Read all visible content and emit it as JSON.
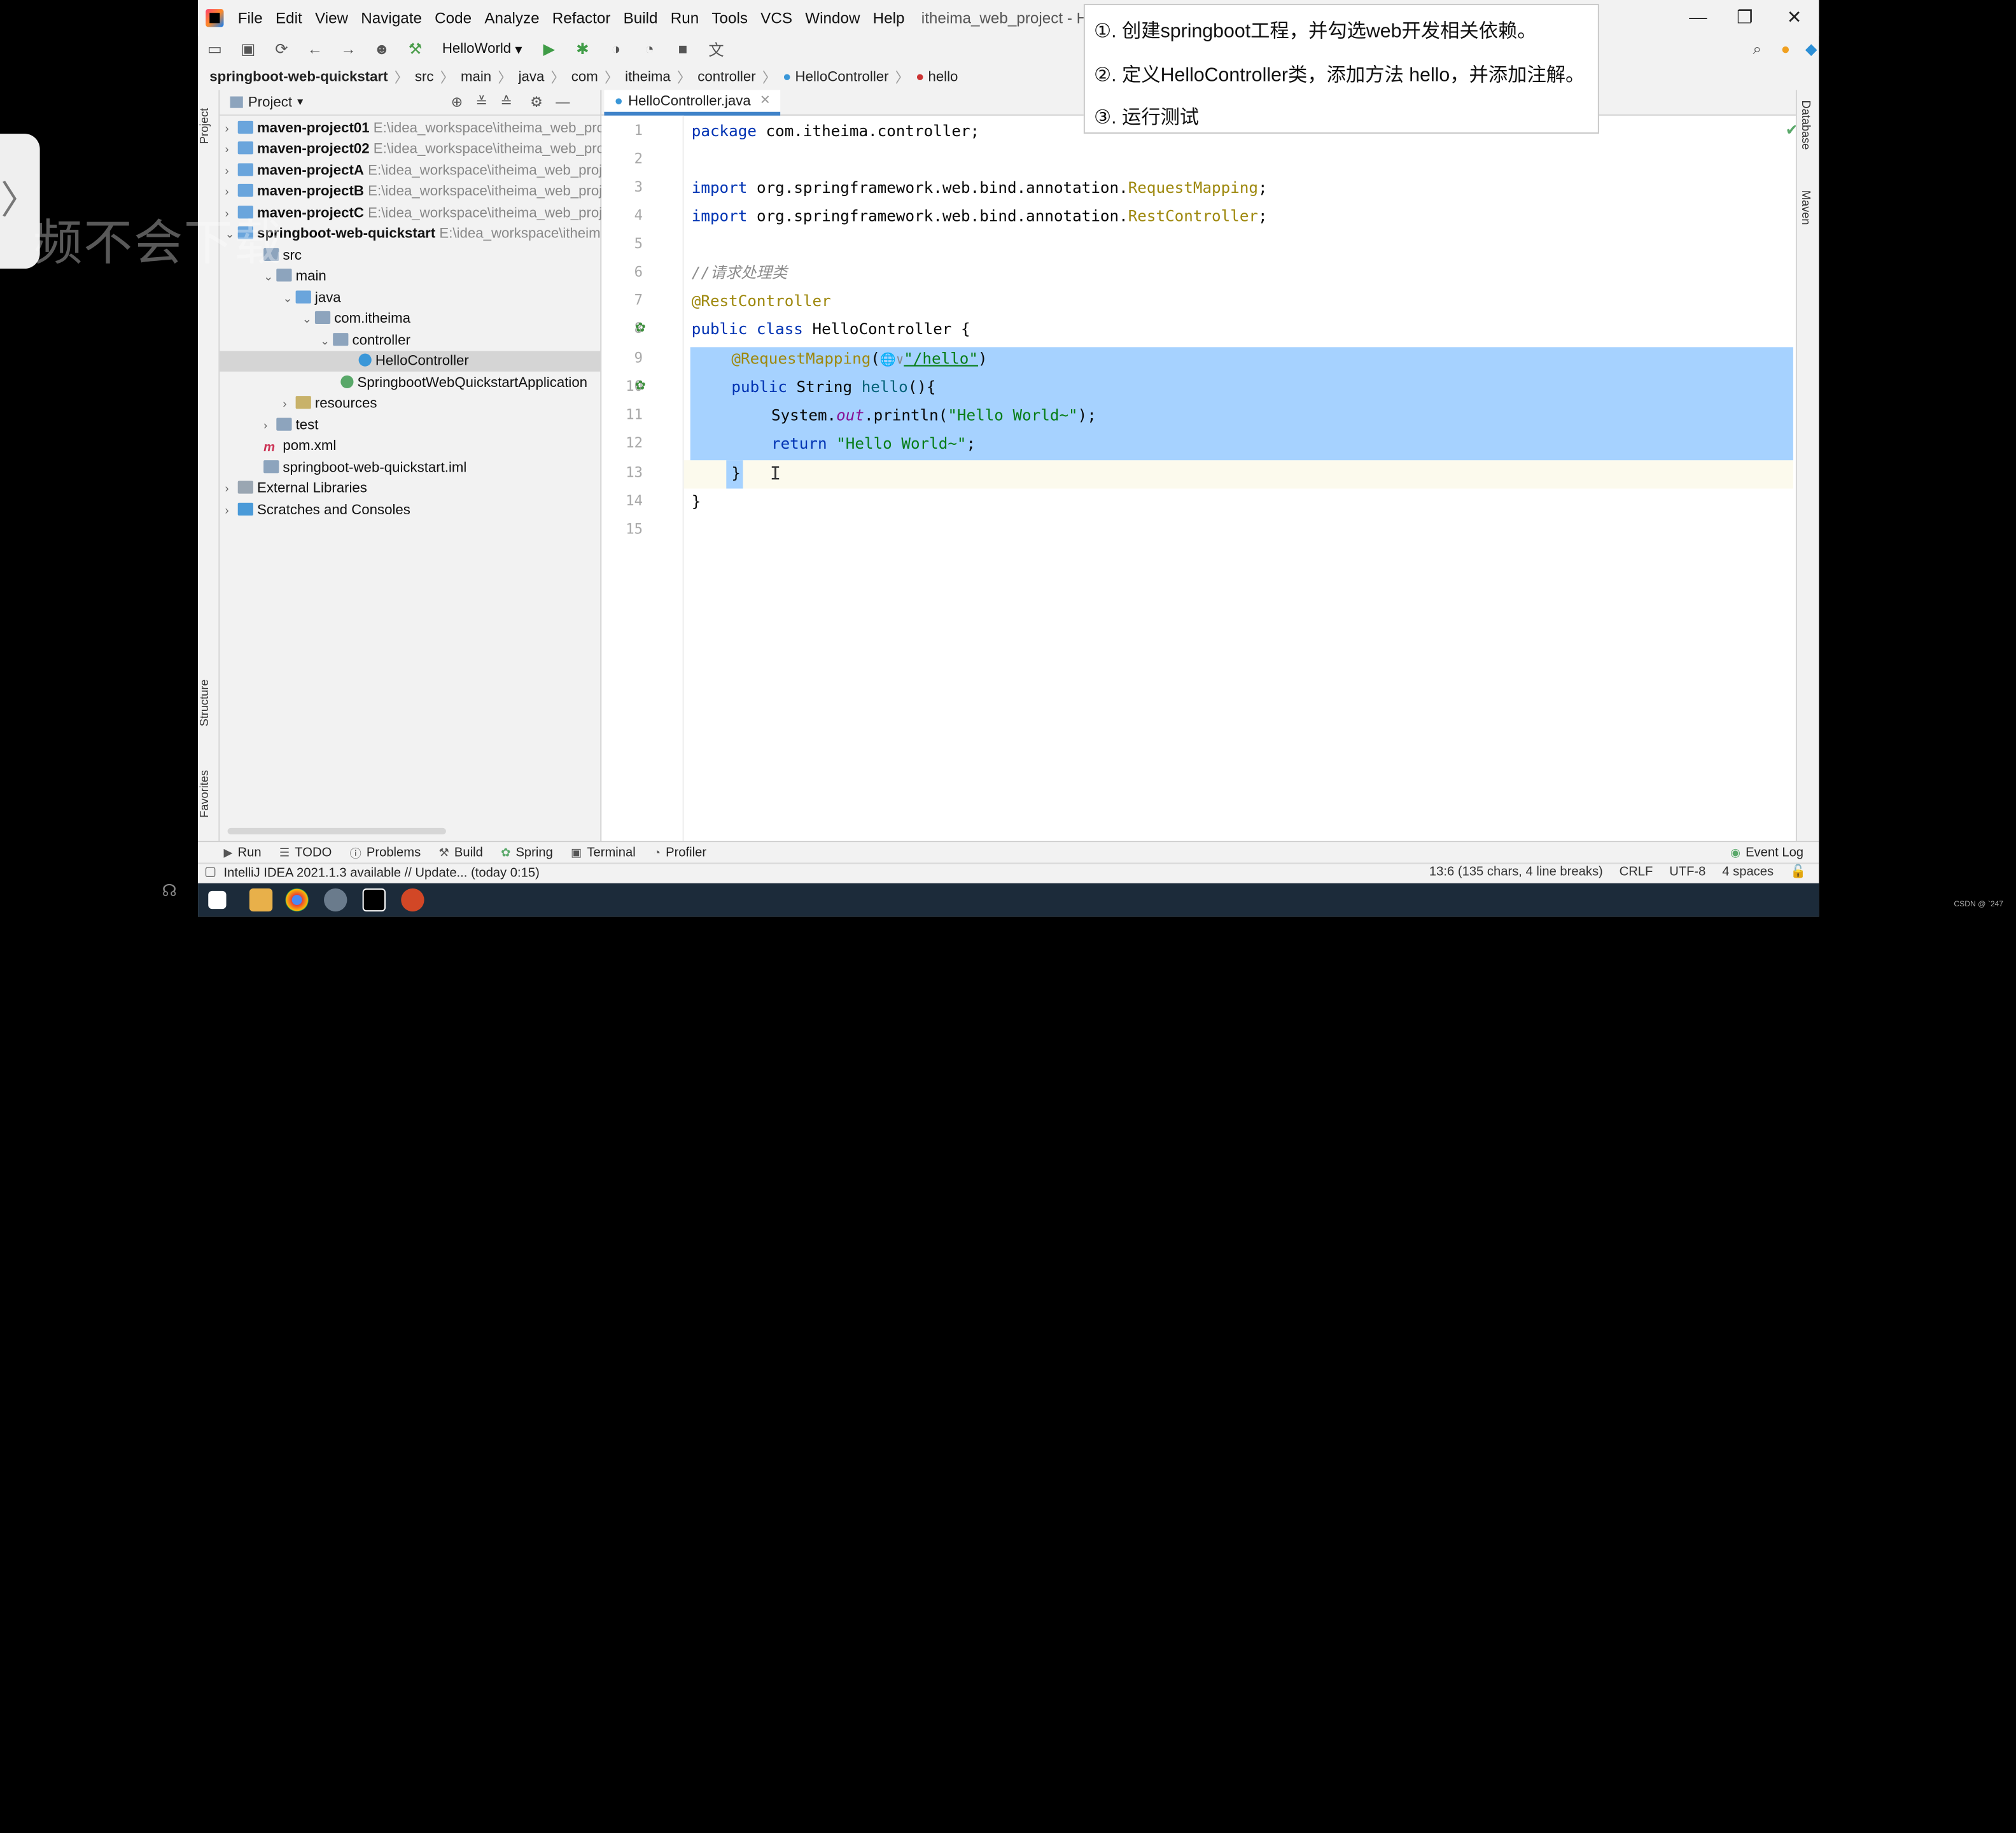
{
  "overlay": {
    "side_arrow": "〉",
    "text": "频不会下载"
  },
  "menu": {
    "items": [
      "File",
      "Edit",
      "View",
      "Navigate",
      "Code",
      "Analyze",
      "Refactor",
      "Build",
      "Run",
      "Tools",
      "VCS",
      "Window",
      "Help"
    ],
    "window_title": "itheima_web_project - HelloContr"
  },
  "toolbar": {
    "run_config": "HelloWorld"
  },
  "breadcrumb": [
    "springboot-web-quickstart",
    "src",
    "main",
    "java",
    "com",
    "itheima",
    "controller",
    "HelloController",
    "hello"
  ],
  "project_panel": {
    "title": "Project",
    "tree": [
      {
        "label": "maven-project01",
        "path": "E:\\idea_workspace\\itheima_web_pro"
      },
      {
        "label": "maven-project02",
        "path": "E:\\idea_workspace\\itheima_web_pro"
      },
      {
        "label": "maven-projectA",
        "path": "E:\\idea_workspace\\itheima_web_proj"
      },
      {
        "label": "maven-projectB",
        "path": "E:\\idea_workspace\\itheima_web_proj"
      },
      {
        "label": "maven-projectC",
        "path": "E:\\idea_workspace\\itheima_web_proj"
      },
      {
        "label": "springboot-web-quickstart",
        "path": "E:\\idea_workspace\\itheim"
      },
      {
        "label": "src"
      },
      {
        "label": "main"
      },
      {
        "label": "java"
      },
      {
        "label": "com.itheima"
      },
      {
        "label": "controller"
      },
      {
        "label": "HelloController"
      },
      {
        "label": "SpringbootWebQuickstartApplication"
      },
      {
        "label": "resources"
      },
      {
        "label": "test"
      },
      {
        "label": "pom.xml"
      },
      {
        "label": "springboot-web-quickstart.iml"
      },
      {
        "label": "External Libraries"
      },
      {
        "label": "Scratches and Consoles"
      }
    ]
  },
  "editor": {
    "tab_label": "HelloController.java",
    "line_numbers": [
      "1",
      "2",
      "3",
      "4",
      "5",
      "6",
      "7",
      "8",
      "9",
      "10",
      "11",
      "12",
      "13",
      "14",
      "15"
    ],
    "code": {
      "l1_kw": "package",
      "l1_rest": " com.itheima.controller;",
      "l3_kw": "import",
      "l3_rest": " org.springframework.web.bind.annotation.",
      "l3_ann": "RequestMapping",
      "l3_end": ";",
      "l4_kw": "import",
      "l4_rest": " org.springframework.web.bind.annotation.",
      "l4_ann": "RestController",
      "l4_end": ";",
      "l6_cmt": "//请求处理类",
      "l7_ann": "@RestController",
      "l8_kw": "public class",
      "l8_rest": " HelloController {",
      "l9_ann": "@RequestMapping",
      "l9_mid": "(",
      "l9_globe": "🌐∨",
      "l9_str": "\"/hello\"",
      "l9_end": ")",
      "l10_kw": "public",
      "l10_type": " String ",
      "l10_fn": "hello",
      "l10_end": "(){",
      "l11_a": "System.",
      "l11_fld": "out",
      "l11_b": ".println(",
      "l11_str": "\"Hello World~\"",
      "l11_c": ");",
      "l12_kw": "return",
      "l12_sp": " ",
      "l12_str": "\"Hello World~\"",
      "l12_end": ";",
      "l13": "}",
      "l14": "}"
    }
  },
  "right_strip": {
    "database": "Database",
    "maven": "Maven"
  },
  "left_strip": {
    "project": "Project",
    "structure": "Structure",
    "favorites": "Favorites"
  },
  "bottom_tabs": [
    "Run",
    "TODO",
    "Problems",
    "Build",
    "Spring",
    "Terminal",
    "Profiler",
    "Event Log"
  ],
  "status": {
    "message": "IntelliJ IDEA 2021.1.3 available // Update... (today 0:15)",
    "position": "13:6 (135 chars, 4 line breaks)",
    "line_sep": "CRLF",
    "encoding": "UTF-8",
    "indent": "4 spaces"
  },
  "popup": {
    "steps": [
      "①. 创建springboot工程，并勾选web开发相关依赖。",
      "②. 定义HelloController类，添加方法 hello，并添加注解。",
      "③. 运行测试"
    ]
  },
  "watermark": "CSDN @ `247"
}
